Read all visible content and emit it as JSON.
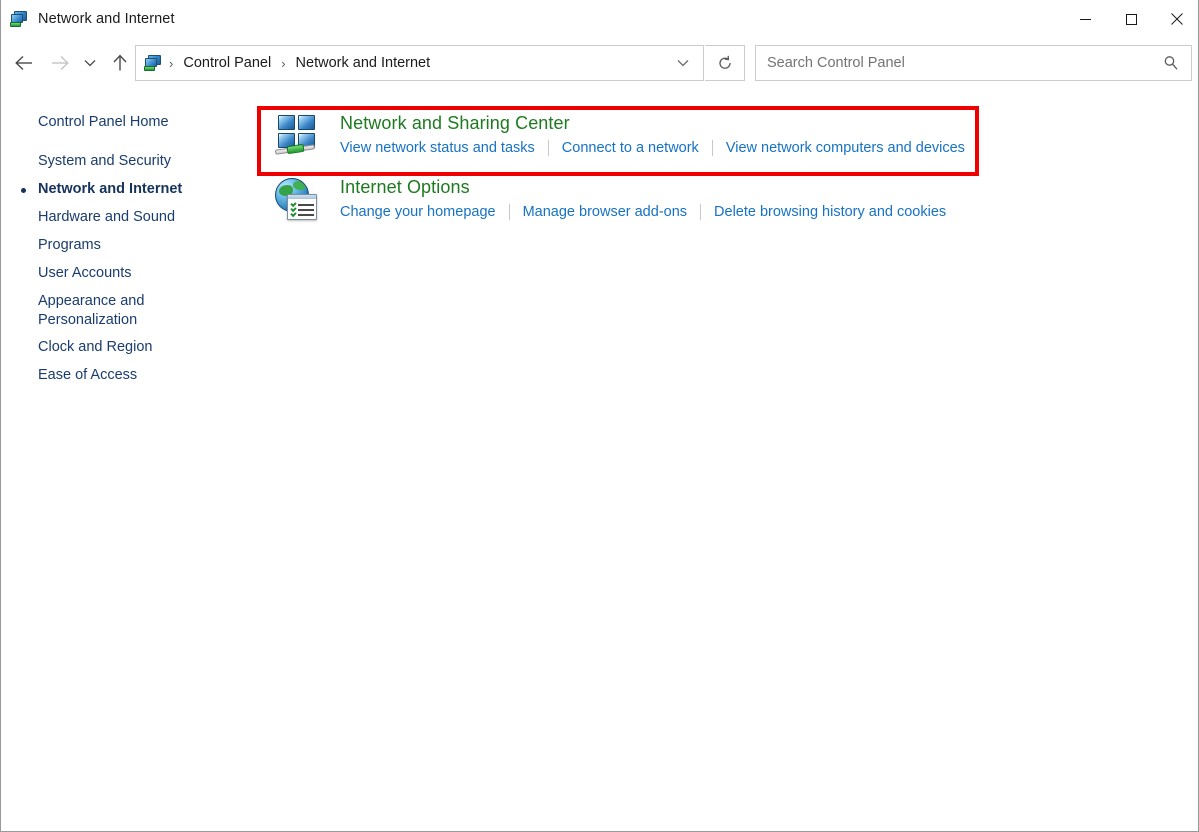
{
  "window": {
    "title": "Network and Internet",
    "title_icon": "network-icon",
    "controls": {
      "minimize": "minimize-icon",
      "maximize": "maximize-icon",
      "close": "close-icon"
    }
  },
  "navbar": {
    "back": "back-arrow-icon",
    "forward": "forward-arrow-icon",
    "recent": "recent-locations-chevron-icon",
    "up": "up-arrow-icon",
    "address_icon": "network-icon",
    "breadcrumbs": [
      "Control Panel",
      "Network and Internet"
    ],
    "breadcrumb_separator": "›",
    "dropdown": "chevron-down-icon",
    "refresh": "refresh-icon"
  },
  "search": {
    "placeholder": "Search Control Panel",
    "value": "",
    "icon": "search-icon"
  },
  "sidebar": {
    "home": "Control Panel Home",
    "items": [
      {
        "label": "System and Security",
        "current": false
      },
      {
        "label": "Network and Internet",
        "current": true
      },
      {
        "label": "Hardware and Sound",
        "current": false
      },
      {
        "label": "Programs",
        "current": false
      },
      {
        "label": "User Accounts",
        "current": false
      },
      {
        "label": "Appearance and Personalization",
        "current": false
      },
      {
        "label": "Clock and Region",
        "current": false
      },
      {
        "label": "Ease of Access",
        "current": false
      }
    ]
  },
  "content": {
    "categories": [
      {
        "icon": "network-and-sharing-center-icon",
        "title": "Network and Sharing Center",
        "links": [
          "View network status and tasks",
          "Connect to a network",
          "View network computers and devices"
        ]
      },
      {
        "icon": "internet-options-icon",
        "title": "Internet Options",
        "links": [
          "Change your homepage",
          "Manage browser add-ons",
          "Delete browsing history and cookies"
        ]
      }
    ]
  },
  "annotation": {
    "highlight_color": "#ee0000",
    "target": "Network and Sharing Center"
  }
}
